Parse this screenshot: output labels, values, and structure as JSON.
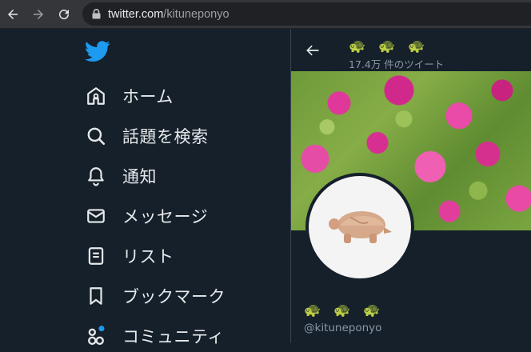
{
  "browser": {
    "url_host": "twitter.com",
    "url_path": "/kituneponyo"
  },
  "nav": {
    "items": [
      {
        "label": "ホーム",
        "icon": "home-icon"
      },
      {
        "label": "話題を検索",
        "icon": "search-icon"
      },
      {
        "label": "通知",
        "icon": "bell-icon"
      },
      {
        "label": "メッセージ",
        "icon": "mail-icon"
      },
      {
        "label": "リスト",
        "icon": "list-icon"
      },
      {
        "label": "ブックマーク",
        "icon": "bookmark-icon"
      },
      {
        "label": "コミュニティ",
        "icon": "communities-icon"
      }
    ]
  },
  "profile": {
    "display_name": "🐢🐢🐢",
    "tweet_count": "17.4万 件のツイート",
    "handle": "@kituneponyo"
  },
  "colors": {
    "background": "#15202b",
    "brand": "#1d9bf0",
    "text": "#e7e9ea",
    "muted": "#8b98a5"
  }
}
